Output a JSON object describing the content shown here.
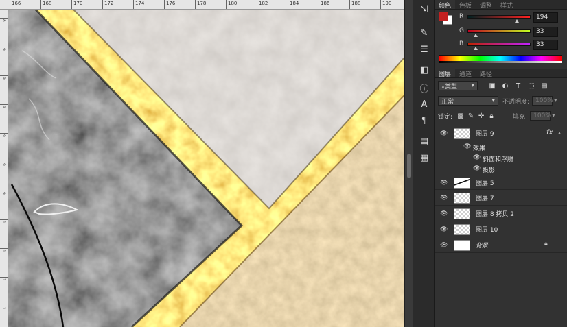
{
  "ruler": {
    "top_labels": [
      "166",
      "168",
      "170",
      "172",
      "174",
      "176",
      "178",
      "180",
      "182",
      "184",
      "186",
      "188",
      "190"
    ],
    "left_labels": [
      "8",
      "9",
      "9",
      "9",
      "9",
      "9",
      "9",
      "1",
      "1",
      "1",
      "1"
    ]
  },
  "tools": [
    "tool-move-icon",
    "tool-brush-icon",
    "tool-adjust-icon",
    "tool-3d-icon",
    "tool-info-icon",
    "tool-character-icon",
    "tool-paragraph-icon",
    "tool-layers-icon",
    "tool-notes-icon"
  ],
  "color_panel": {
    "tabs": [
      "颜色",
      "色板",
      "调整",
      "样式"
    ],
    "foreground_color": "#c22121",
    "background_color": "#ffffff",
    "channels": [
      {
        "label": "R",
        "value": "194"
      },
      {
        "label": "G",
        "value": "33"
      },
      {
        "label": "B",
        "value": "33"
      }
    ]
  },
  "layers_panel": {
    "tabs": [
      "图层",
      "通道",
      "路径"
    ],
    "filter_kind": "类型",
    "blend_mode": "正常",
    "opacity_label": "不透明度:",
    "opacity_value": "100%",
    "lock_label": "锁定:",
    "fill_label": "填充:",
    "fill_value": "100%",
    "layers": [
      {
        "name": "图层 9",
        "fx": "fx"
      },
      {
        "name": "效果"
      },
      {
        "name": "斜面和浮雕"
      },
      {
        "name": "投影"
      },
      {
        "name": "图层 5"
      },
      {
        "name": "图层 7"
      },
      {
        "name": "图层 8 拷贝 2"
      },
      {
        "name": "图层 10"
      },
      {
        "name": "背景"
      }
    ]
  }
}
